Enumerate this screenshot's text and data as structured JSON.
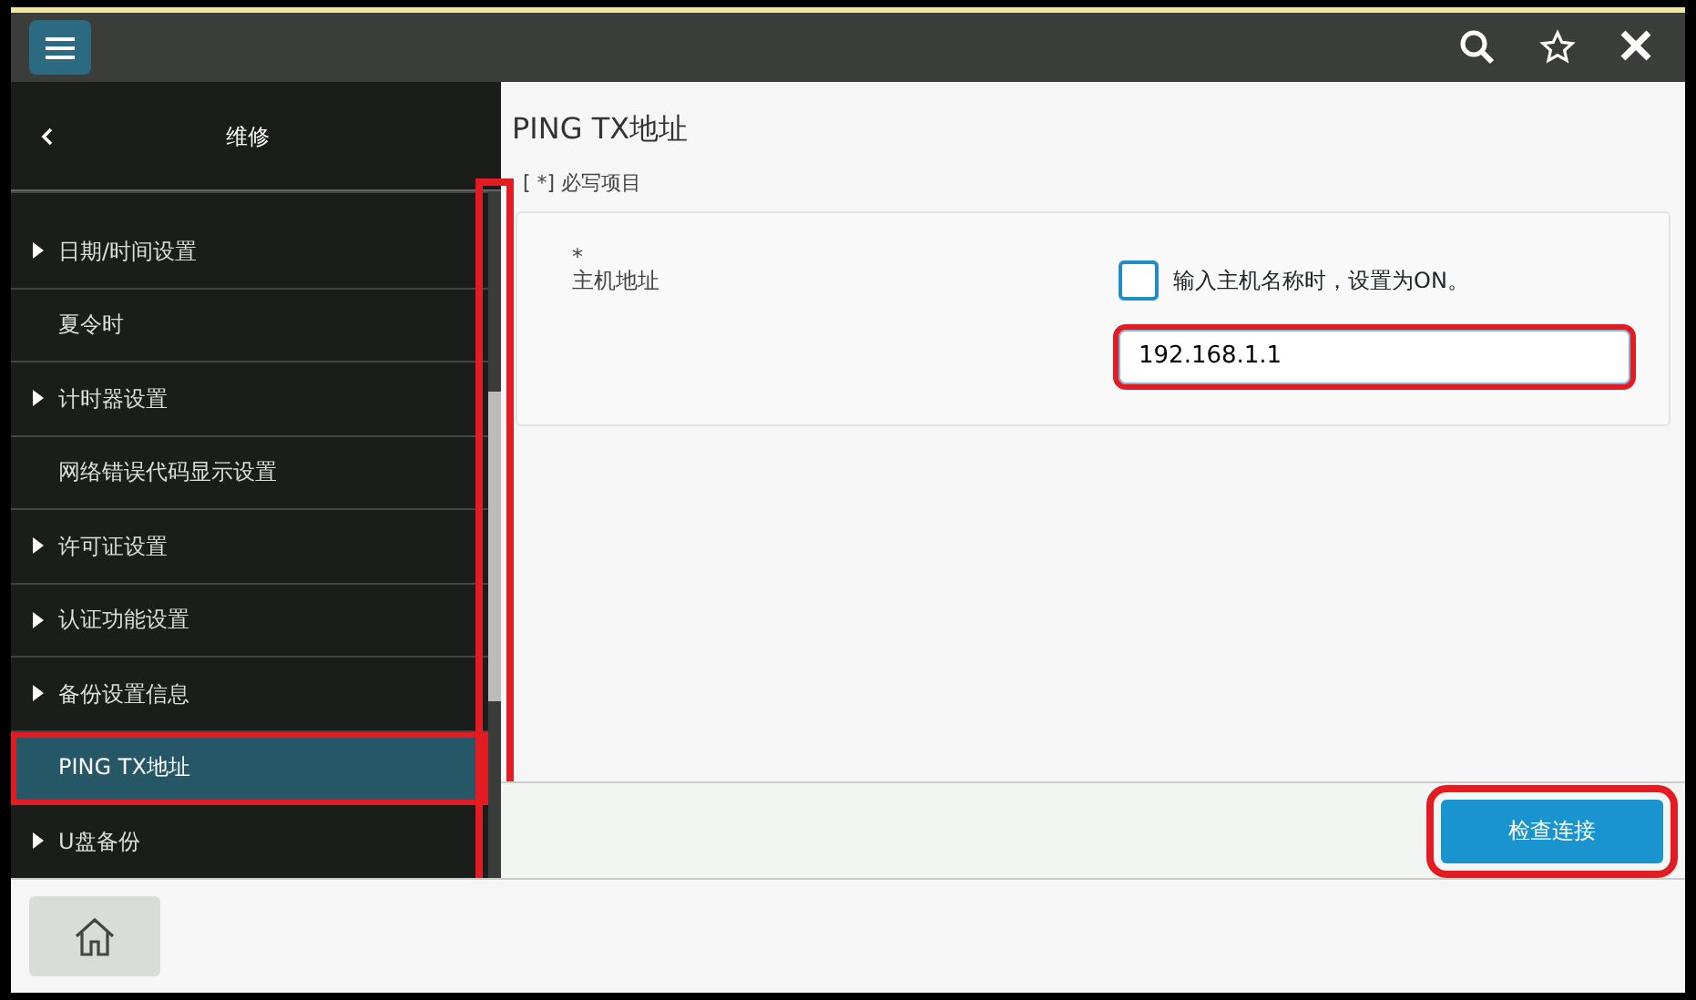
{
  "sidebar": {
    "title": "维修",
    "scrollbar": {
      "highlighted": true
    },
    "items": [
      {
        "label": "日期/时间设置",
        "expandable": true,
        "selected": false,
        "highlighted": false
      },
      {
        "label": "夏令时",
        "expandable": false,
        "selected": false,
        "highlighted": false
      },
      {
        "label": "计时器设置",
        "expandable": true,
        "selected": false,
        "highlighted": false
      },
      {
        "label": "网络错误代码显示设置",
        "expandable": false,
        "selected": false,
        "highlighted": false
      },
      {
        "label": "许可证设置",
        "expandable": true,
        "selected": false,
        "highlighted": false
      },
      {
        "label": "认证功能设置",
        "expandable": true,
        "selected": false,
        "highlighted": false
      },
      {
        "label": "备份设置信息",
        "expandable": true,
        "selected": false,
        "highlighted": false
      },
      {
        "label": "PING TX地址",
        "expandable": false,
        "selected": true,
        "highlighted": true
      },
      {
        "label": "U盘备份",
        "expandable": true,
        "selected": false,
        "highlighted": false
      }
    ]
  },
  "page": {
    "title": "PING TX地址",
    "required_note": "[ *] 必写项目",
    "form": {
      "required_mark": "*",
      "label": "主机地址",
      "checkbox": {
        "label": "输入主机名称时，设置为ON。",
        "checked": false
      },
      "field": {
        "value": "192.168.1.1",
        "highlighted": true
      }
    },
    "button": {
      "label": "检查连接",
      "highlighted": true
    }
  }
}
